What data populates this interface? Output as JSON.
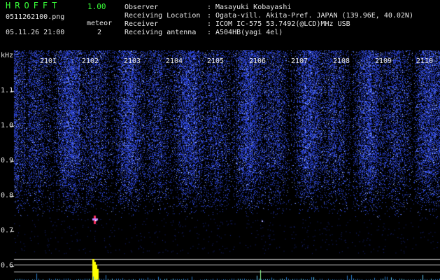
{
  "header": {
    "brand": "HROFFT",
    "version": "1.00",
    "filename": "0511262100.png",
    "datetime": "05.11.26 21:00",
    "meteor_label": "meteor",
    "meteor_count": "2"
  },
  "info": [
    {
      "label": "Observer",
      "value": "Masayuki Kobayashi"
    },
    {
      "label": "Receiving Location",
      "value": "Ogata-vill. Akita-Pref. JAPAN (139.96E, 40.02N)"
    },
    {
      "label": "Receiver",
      "value": "ICOM IC-575 53.7492(@LCD)MHz USB"
    },
    {
      "label": "Receiving antenna",
      "value": "A504HB(yagi 4el)"
    }
  ],
  "spectrogram": {
    "y_unit": "kHz",
    "y_ticks": [
      "1.1",
      "1.0",
      "0.9",
      "0.8",
      "0.7",
      "0.6"
    ],
    "x_ticks": [
      "2101",
      "2102",
      "2103",
      "2104",
      "2105",
      "2106",
      "2107",
      "2108",
      "2109",
      "2110"
    ],
    "colors": {
      "noise": "#2a3cc8",
      "bright": "#9fb8ff",
      "grid": "#cfcfcf",
      "meteor": "#ff3060",
      "histogram": "#ffff00"
    }
  }
}
